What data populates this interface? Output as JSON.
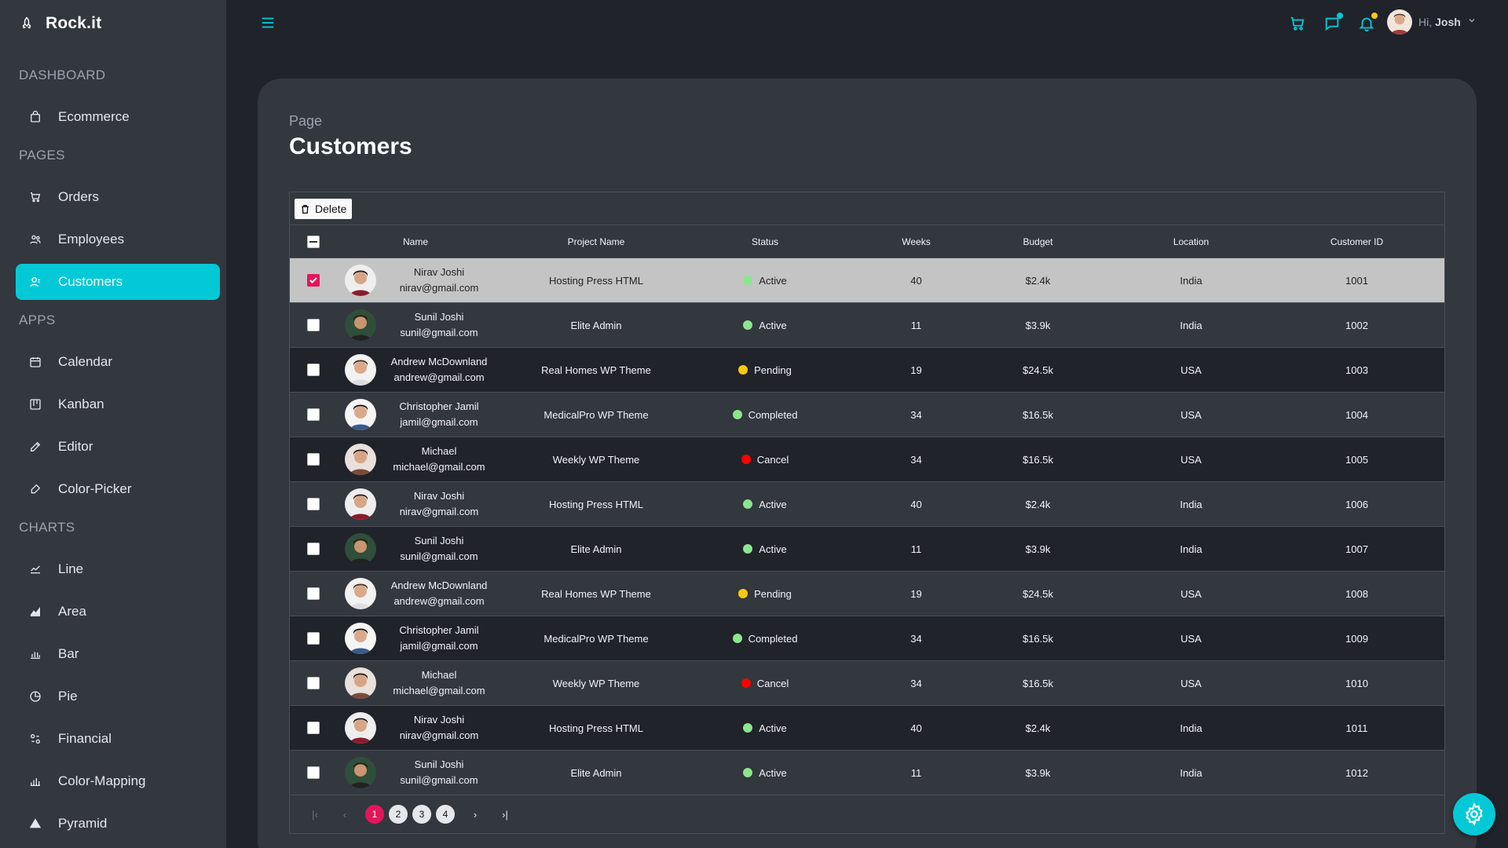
{
  "brand": {
    "name": "Rock.it"
  },
  "sidebar": {
    "sections": [
      {
        "title": "DASHBOARD",
        "items": [
          {
            "label": "Ecommerce",
            "icon": "shopping-bag-icon"
          }
        ]
      },
      {
        "title": "PAGES",
        "items": [
          {
            "label": "Orders",
            "icon": "cart-icon"
          },
          {
            "label": "Employees",
            "icon": "users-icon"
          },
          {
            "label": "Customers",
            "icon": "user-icon",
            "active": true
          }
        ]
      },
      {
        "title": "APPS",
        "items": [
          {
            "label": "Calendar",
            "icon": "calendar-icon"
          },
          {
            "label": "Kanban",
            "icon": "kanban-icon"
          },
          {
            "label": "Editor",
            "icon": "edit-icon"
          },
          {
            "label": "Color-Picker",
            "icon": "color-picker-icon"
          }
        ]
      },
      {
        "title": "CHARTS",
        "items": [
          {
            "label": "Line",
            "icon": "line-chart-icon"
          },
          {
            "label": "Area",
            "icon": "area-chart-icon"
          },
          {
            "label": "Bar",
            "icon": "bar-chart-icon"
          },
          {
            "label": "Pie",
            "icon": "pie-chart-icon"
          },
          {
            "label": "Financial",
            "icon": "financial-icon"
          },
          {
            "label": "Color-Mapping",
            "icon": "color-mapping-icon"
          },
          {
            "label": "Pyramid",
            "icon": "pyramid-icon"
          }
        ]
      }
    ]
  },
  "topbar": {
    "greeting": "Hi,",
    "user_name": "Josh"
  },
  "page": {
    "subtitle": "Page",
    "title": "Customers"
  },
  "toolbar": {
    "delete_label": "Delete"
  },
  "table": {
    "headers": [
      "Name",
      "Project Name",
      "Status",
      "Weeks",
      "Budget",
      "Location",
      "Customer ID"
    ],
    "rows": [
      {
        "name": "Nirav Joshi",
        "email": "nirav@gmail.com",
        "project": "Hosting Press HTML",
        "status": "Active",
        "weeks": "40",
        "budget": "$2.4k",
        "location": "India",
        "cid": "1001",
        "selected": true
      },
      {
        "name": "Sunil Joshi",
        "email": "sunil@gmail.com",
        "project": "Elite Admin",
        "status": "Active",
        "weeks": "11",
        "budget": "$3.9k",
        "location": "India",
        "cid": "1002"
      },
      {
        "name": "Andrew McDownland",
        "email": "andrew@gmail.com",
        "project": "Real Homes WP Theme",
        "status": "Pending",
        "weeks": "19",
        "budget": "$24.5k",
        "location": "USA",
        "cid": "1003"
      },
      {
        "name": "Christopher Jamil",
        "email": "jamil@gmail.com",
        "project": "MedicalPro WP Theme",
        "status": "Completed",
        "weeks": "34",
        "budget": "$16.5k",
        "location": "USA",
        "cid": "1004"
      },
      {
        "name": "Michael",
        "email": "michael@gmail.com",
        "project": "Weekly WP Theme",
        "status": "Cancel",
        "weeks": "34",
        "budget": "$16.5k",
        "location": "USA",
        "cid": "1005"
      },
      {
        "name": "Nirav Joshi",
        "email": "nirav@gmail.com",
        "project": "Hosting Press HTML",
        "status": "Active",
        "weeks": "40",
        "budget": "$2.4k",
        "location": "India",
        "cid": "1006"
      },
      {
        "name": "Sunil Joshi",
        "email": "sunil@gmail.com",
        "project": "Elite Admin",
        "status": "Active",
        "weeks": "11",
        "budget": "$3.9k",
        "location": "India",
        "cid": "1007"
      },
      {
        "name": "Andrew McDownland",
        "email": "andrew@gmail.com",
        "project": "Real Homes WP Theme",
        "status": "Pending",
        "weeks": "19",
        "budget": "$24.5k",
        "location": "USA",
        "cid": "1008"
      },
      {
        "name": "Christopher Jamil",
        "email": "jamil@gmail.com",
        "project": "MedicalPro WP Theme",
        "status": "Completed",
        "weeks": "34",
        "budget": "$16.5k",
        "location": "USA",
        "cid": "1009"
      },
      {
        "name": "Michael",
        "email": "michael@gmail.com",
        "project": "Weekly WP Theme",
        "status": "Cancel",
        "weeks": "34",
        "budget": "$16.5k",
        "location": "USA",
        "cid": "1010"
      },
      {
        "name": "Nirav Joshi",
        "email": "nirav@gmail.com",
        "project": "Hosting Press HTML",
        "status": "Active",
        "weeks": "40",
        "budget": "$2.4k",
        "location": "India",
        "cid": "1011"
      },
      {
        "name": "Sunil Joshi",
        "email": "sunil@gmail.com",
        "project": "Elite Admin",
        "status": "Active",
        "weeks": "11",
        "budget": "$3.9k",
        "location": "India",
        "cid": "1012"
      }
    ]
  },
  "status_colors": {
    "Active": "#8be78b",
    "Pending": "#fec90f",
    "Completed": "#8be78b",
    "Cancel": "#ff0000"
  },
  "pagination": {
    "pages": [
      "1",
      "2",
      "3",
      "4"
    ],
    "current": "1"
  },
  "colors": {
    "accent": "#03c9d7",
    "selected_check": "#e3165b",
    "notification_dot": "#fec90f"
  }
}
